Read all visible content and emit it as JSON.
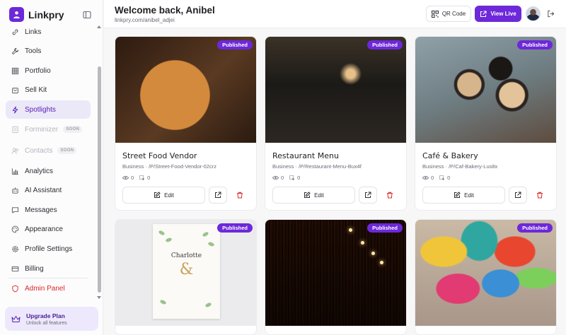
{
  "brand": {
    "name": "Linkpry"
  },
  "sidebar": {
    "items": [
      {
        "label": "Links",
        "icon": "link-icon",
        "state": "normal"
      },
      {
        "label": "Tools",
        "icon": "wrench-icon",
        "state": "normal"
      },
      {
        "label": "Portfolio",
        "icon": "grid-icon",
        "state": "normal"
      },
      {
        "label": "Sell Kit",
        "icon": "bag-icon",
        "state": "normal"
      },
      {
        "label": "Spotlights",
        "icon": "lightning-icon",
        "state": "active"
      },
      {
        "label": "Forminizer",
        "icon": "form-icon",
        "state": "disabled",
        "badge": "SOON"
      },
      {
        "label": "Contacts",
        "icon": "users-icon",
        "state": "disabled",
        "badge": "SOON"
      },
      {
        "label": "Analytics",
        "icon": "bar-chart-icon",
        "state": "normal"
      },
      {
        "label": "AI Assistant",
        "icon": "robot-icon",
        "state": "normal"
      },
      {
        "label": "Messages",
        "icon": "message-icon",
        "state": "normal"
      },
      {
        "label": "Appearance",
        "icon": "palette-icon",
        "state": "normal"
      },
      {
        "label": "Profile Settings",
        "icon": "gear-icon",
        "state": "normal"
      },
      {
        "label": "Billing",
        "icon": "credit-card-icon",
        "state": "normal"
      },
      {
        "label": "Admin Panel",
        "icon": "shield-icon",
        "state": "danger"
      }
    ],
    "upgrade": {
      "title": "Upgrade Plan",
      "subtitle": "Unlock all features"
    }
  },
  "header": {
    "welcome": "Welcome back, Anibel",
    "subtitle": "linkpry.com/anibel_adjei",
    "qr_label": "QR Code",
    "live_label": "View Live"
  },
  "cards": [
    {
      "title": "Street Food Vendor",
      "meta": "Business · /P/Street-Food-Vendor-02crz",
      "views": "0",
      "clicks": "0",
      "badge": "Published",
      "edit_label": "Edit",
      "image": "pizza"
    },
    {
      "title": "Restaurant Menu",
      "meta": "Business · /P/Restaurant-Menu-Bux4f",
      "views": "0",
      "clicks": "0",
      "badge": "Published",
      "edit_label": "Edit",
      "image": "restaurant"
    },
    {
      "title": "Café & Bakery",
      "meta": "Business · /P/Caf-Bakery-Lus8x",
      "views": "0",
      "clicks": "0",
      "badge": "Published",
      "edit_label": "Edit",
      "image": "coffee"
    },
    {
      "badge": "Published",
      "image": "invitation",
      "invite_name": "Charlotte",
      "invite_amp": "&"
    },
    {
      "badge": "Published",
      "image": "library"
    },
    {
      "badge": "Published",
      "image": "balloons"
    }
  ],
  "colors": {
    "accent": "#6d28d9",
    "danger": "#dc2626",
    "active_bg": "#ebe8f8"
  }
}
